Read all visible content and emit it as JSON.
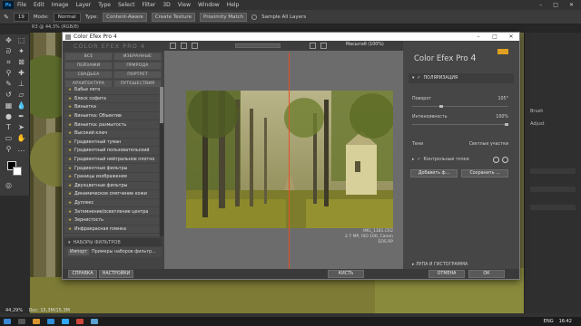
{
  "photoshop": {
    "menu": [
      "File",
      "Edit",
      "Image",
      "Layer",
      "Type",
      "Select",
      "Filter",
      "3D",
      "View",
      "Window",
      "Help"
    ],
    "options": {
      "mode_label": "Mode:",
      "mode_value": "Normal",
      "type_label": "Type:",
      "btn_content_aware": "Content-Aware",
      "btn_create_texture": "Create Texture",
      "btn_proximity": "Proximity Match",
      "sample_all": "Sample All Layers"
    },
    "tab_title": "R3 @ 44,3% (RGB/8)",
    "zoom_status": "44,29%",
    "doc_status": "Doc: 15,3M/15,3M",
    "right_panel": {
      "item1": "Brush",
      "item2": "Adjust"
    },
    "taskbar": {
      "lang": "ENG",
      "time": "16:42"
    }
  },
  "cef": {
    "window_title": "Color Efex Pro 4",
    "brand_text": "COLOR EFEX PRO 4",
    "categories": [
      "ВСЕ",
      "ИЗБРАННЫЕ",
      "ПЕЙЗАЖИ",
      "ПРИРОДА",
      "СВАДЬБА",
      "ПОРТРЕТ",
      "АРХИТЕКТУРА",
      "ПУТЕШЕСТВИЯ"
    ],
    "filters": [
      "Бабье лето",
      "Блеск софита",
      "Виньетка",
      "Виньетка: Объектив",
      "Виньетка: размытость",
      "Высокий ключ",
      "Градиентный туман",
      "Градиентный пользовательский",
      "Градиентный нейтральное плотно",
      "Градиентные фильтры",
      "Границы изображения",
      "Двухцветные фильтры",
      "Динамическое смягчение кожи",
      "Дуплекс",
      "Затемнение/осветление центра",
      "Зернистость",
      "Инфракрасная пленка"
    ],
    "presets_header": "НАБОРЫ ФИЛЬТРОВ",
    "preset_tag": "Импорт",
    "preset_text": "Примеры наборов фильтр...",
    "btn_help": "СПРАВКА",
    "btn_settings": "НАСТРОЙКИ",
    "zoom_label": "Масштаб (100%)",
    "caption_file": "IMG_1181.CR2",
    "caption_info": "2.7 MP, ISO 100, Canon EOS RP",
    "right_title": "Color Efex Pro",
    "right_title_num": "4",
    "section_title": "ПОЛЯРИЗАЦИЯ",
    "rotation_label": "Поворот",
    "rotation_value": "105°",
    "rotation_pct": 0.29,
    "strength_label": "Интенсивность",
    "strength_value": "100%",
    "strength_pct": 1.0,
    "shadows_label": "Тени",
    "highlights_label": "Светлые участки",
    "control_points": "Контрольные точки",
    "btn_add": "Добавить ф...",
    "btn_save": "Сохранить ...",
    "loupe": "ЛУПА И ГИСТОГРАММА",
    "btn_brush": "КИСТЬ",
    "btn_cancel": "ОТМЕНА",
    "btn_ok": "ОК"
  }
}
